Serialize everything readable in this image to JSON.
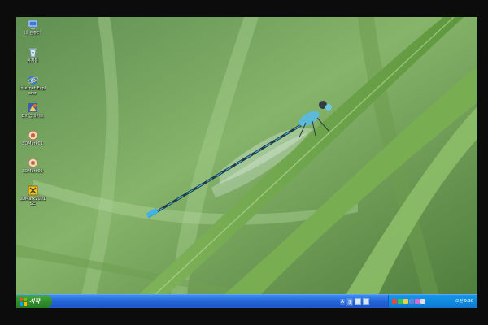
{
  "desktop": {
    "icons": [
      {
        "name": "my-computer-icon",
        "label": "내 컴퓨터"
      },
      {
        "name": "recycle-bin-icon",
        "label": "휴지통"
      },
      {
        "name": "internet-explorer-icon",
        "label": "Internet Explorer"
      },
      {
        "name": "directx-update-icon",
        "label": "DX 업데이트"
      },
      {
        "name": "3dmark01-icon",
        "label": "3DMark01"
      },
      {
        "name": "3dmark05-icon",
        "label": "3DMark05"
      },
      {
        "name": "3dmark2001se-icon",
        "label": "3DMark2001 SE"
      }
    ]
  },
  "taskbar": {
    "start_label": "시작",
    "language": {
      "input_mode": "A",
      "hanja": "漢"
    },
    "clock": "오전 9:30"
  },
  "colors": {
    "taskbar": "#2466d8",
    "start": "#2f8a2b",
    "tray": "#0f86dd"
  }
}
